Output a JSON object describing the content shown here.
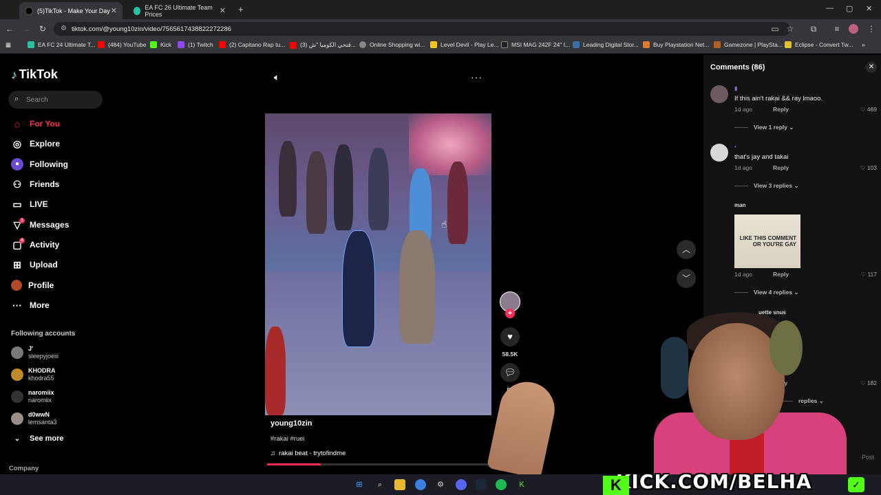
{
  "browser": {
    "tabs": [
      {
        "label": "(5)TikTok - Make Your Day",
        "active": true
      },
      {
        "label": "EA FC 26 Ultimate Team Prices",
        "active": false
      }
    ],
    "url": "tiktok.com/@young10zin/video/7565617438822272286",
    "bookmarks": [
      "EA FC 24 Ultimate T...",
      "(484) YouTube",
      "Kick",
      "(1) Twitch",
      "(2) Capitano Rap tu...",
      "(3) قتحي الكوميا \"ش...",
      "Online Shopping wi...",
      "Level Devil - Play Le...",
      "MSI MAG 242F 24\" I...",
      "Leading Digital Stor...",
      "Buy Playstation Net...",
      "Gamezone | PlaySta...",
      "Eclipse - Convert Tw..."
    ]
  },
  "sidebar": {
    "logo": "TikTok",
    "search_placeholder": "Search",
    "nav": [
      {
        "label": "For You",
        "icon": "home-icon",
        "active": true
      },
      {
        "label": "Explore",
        "icon": "compass-icon"
      },
      {
        "label": "Following",
        "icon": "following-icon"
      },
      {
        "label": "Friends",
        "icon": "friends-icon"
      },
      {
        "label": "LIVE",
        "icon": "live-icon"
      },
      {
        "label": "Messages",
        "icon": "messages-icon",
        "badge": "1"
      },
      {
        "label": "Activity",
        "icon": "activity-icon",
        "badge": "4"
      },
      {
        "label": "Upload",
        "icon": "upload-icon"
      },
      {
        "label": "Profile",
        "icon": "profile-icon"
      },
      {
        "label": "More",
        "icon": "more-icon"
      }
    ],
    "following_title": "Following accounts",
    "accounts": [
      {
        "name": "J'",
        "handle": "sleepyjoeiii"
      },
      {
        "name": "KHODRA",
        "handle": "khodra55"
      },
      {
        "name": "naromiix",
        "handle": "naromiix"
      },
      {
        "name": "d0wwN",
        "handle": "lemsanta3"
      }
    ],
    "see_more": "See more",
    "company": "Company"
  },
  "video": {
    "username": "young10zin",
    "tags": "#rakai #ruei",
    "music": "rakai beat - trytofindme",
    "progress": 0.24,
    "likes": "58.5K",
    "comments": "86"
  },
  "comments_panel": {
    "title": "Comments (86)",
    "items": [
      {
        "text": "If this ain't rakai && ray lmaoo.",
        "time": "1d ago",
        "reply": "Reply",
        "likes": "469",
        "view": "View 1 reply"
      },
      {
        "text": "that's jay and takai",
        "time": "1d ago",
        "reply": "Reply",
        "likes": "103",
        "view": "View 3 replies"
      },
      {
        "name": "man",
        "gif_text": "LIKE THIS COMMENT OR YOU'RE GAY",
        "time": "1d ago",
        "reply": "Reply",
        "likes": "117",
        "view": "View 4 replies"
      },
      {
        "name": "uette snus",
        "reply": "ply",
        "likes": "182",
        "view": "replies"
      }
    ],
    "post": "Post"
  },
  "overlay": {
    "kick_text": "KICK.COM/BELHA",
    "kick_letter": "K"
  },
  "colors": {
    "accent": "#fe2c55",
    "kick_green": "#53fc18"
  }
}
